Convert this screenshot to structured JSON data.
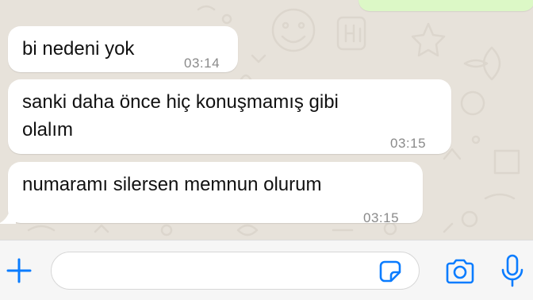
{
  "messages": [
    {
      "text": "bi nedeni yok",
      "time": "03:14"
    },
    {
      "text_line1": "sanki daha önce hiç konuşmamış gibi",
      "text_line2": "olalım",
      "time": "03:15"
    },
    {
      "text": "numaramı silersen memnun olurum",
      "time": "03:15"
    }
  ],
  "input_bar": {
    "message_value": "",
    "icons": {
      "add": "plus-icon",
      "sticker": "sticker-icon",
      "camera": "camera-icon",
      "voice": "microphone-icon"
    }
  },
  "colors": {
    "accent": "#0a7cff",
    "chat_background": "#e7e2da",
    "incoming_bubble": "#ffffff",
    "outgoing_bubble": "#dcf8c6",
    "timestamp": "#8a8a8a",
    "input_bar": "#f6f6f6"
  }
}
